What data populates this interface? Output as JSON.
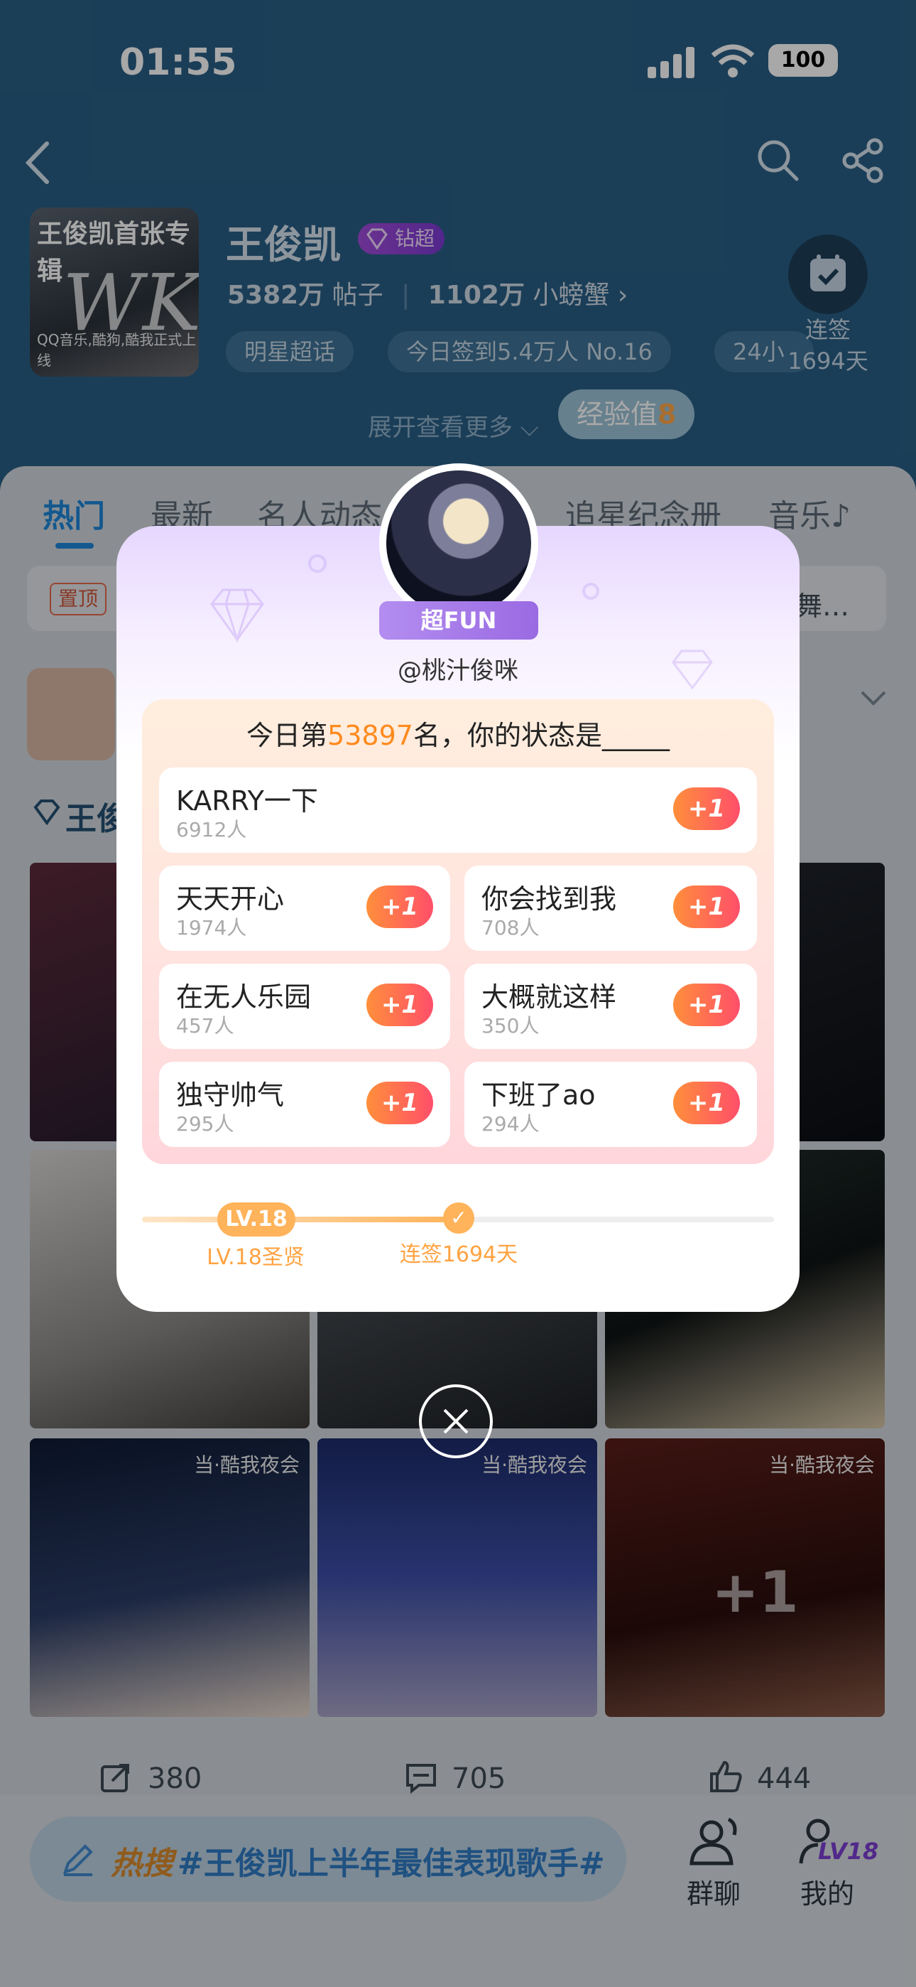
{
  "status_bar": {
    "time": "01:55",
    "battery": "100"
  },
  "header": {
    "album_title": "王俊凯首张专辑",
    "album_bottom": "QQ音乐,酷狗,酷我正式上线",
    "album_logo": "WK",
    "name": "王俊凯",
    "badge": "钻超",
    "posts_count": "5382万",
    "posts_label": "帖子",
    "fans_count": "1102万",
    "fans_label": "小螃蟹 ›",
    "chips": [
      "明星超话",
      "今日签到5.4万人 No.16",
      "24小"
    ],
    "checkin_label": "连签",
    "checkin_days": "1694天",
    "expand_label": "展开查看更多 ⌵",
    "exp_label": "经验值",
    "exp_value": "8"
  },
  "tabs": [
    "热门",
    "最新",
    "名人动态",
    "追星纪念册",
    "音乐♪"
  ],
  "pinned": {
    "tag": "置顶",
    "tail": "舞…"
  },
  "section_title": "王俊",
  "photo_caption": "当·酷我夜会",
  "photo_plus": "+1",
  "post_counts": {
    "share": "380",
    "comment": "705",
    "like": "444"
  },
  "bottom": {
    "hot_tag": "热搜",
    "hot_topic": "#王俊凯上半年最佳表现歌手#",
    "group_chat": "群聊",
    "mine": "我的",
    "mine_level": "LV18"
  },
  "modal": {
    "badge": "超FUN",
    "username": "@桃汁俊咪",
    "question_prefix": "今日第",
    "rank": "53897",
    "question_suffix": "名，你的状态是_____",
    "options": [
      {
        "label": "KARRY一下",
        "count": "6912人"
      },
      {
        "label": "天天开心",
        "count": "1974人"
      },
      {
        "label": "你会找到我",
        "count": "708人"
      },
      {
        "label": "在无人乐园",
        "count": "457人"
      },
      {
        "label": "大概就这样",
        "count": "350人"
      },
      {
        "label": "独守帅气",
        "count": "295人"
      },
      {
        "label": "下班了ao",
        "count": "294人"
      }
    ],
    "plus_label": "+1",
    "level_pill": "LV.18",
    "level_caption": "LV.18圣贤",
    "days_caption": "连签1694天"
  },
  "colors": {
    "header_bg": "#2a5f86",
    "accent_blue": "#1e86d9",
    "accent_orange": "#ff8a1e",
    "modal_purple": "#9a6ae2"
  }
}
